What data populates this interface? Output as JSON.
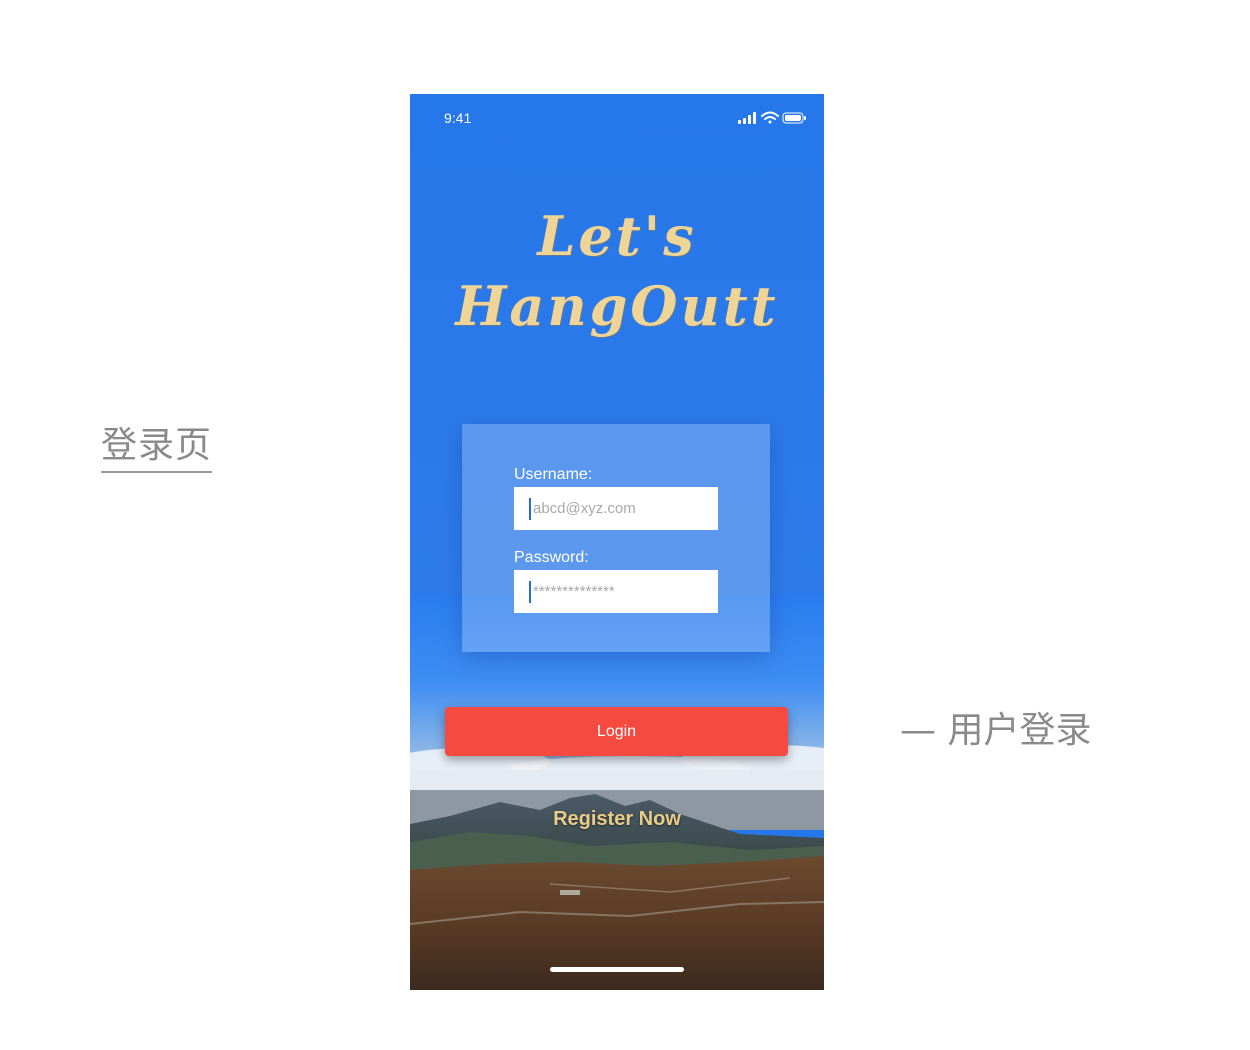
{
  "annotations": {
    "page_label": "登录页",
    "note": "— 用户登录"
  },
  "status_bar": {
    "time": "9:41",
    "icons": [
      "cellular-signal-icon",
      "wifi-icon",
      "battery-icon"
    ]
  },
  "brand": {
    "line1": "Let's",
    "line2": "HangOutt"
  },
  "form": {
    "username_label": "Username:",
    "username_placeholder": "abcd@xyz.com",
    "password_label": "Password:",
    "password_placeholder": "**************"
  },
  "actions": {
    "login_label": "Login",
    "register_label": "Register Now"
  },
  "colors": {
    "sky_blue": "#2677ea",
    "brand_text": "#eed597",
    "login_button": "#f44a40",
    "register_text": "#e9cc86"
  }
}
